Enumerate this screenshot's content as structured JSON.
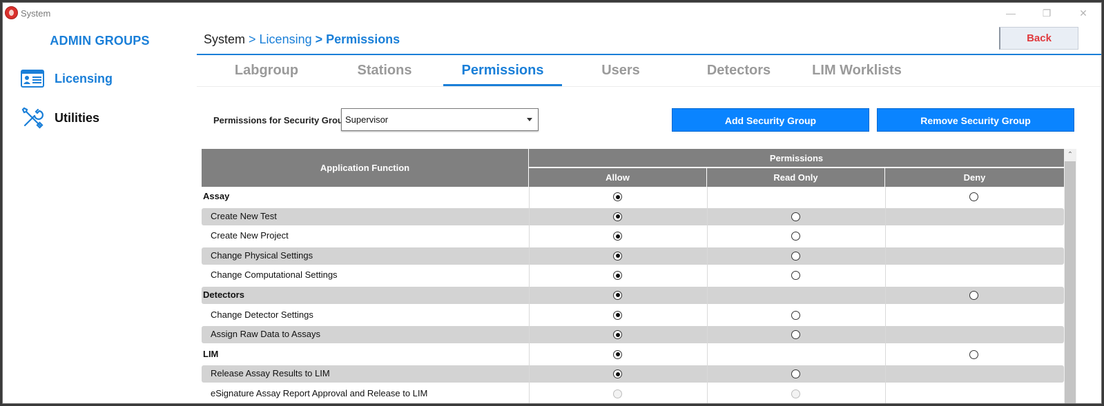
{
  "window": {
    "title": "System",
    "controls": {
      "minimize": "—",
      "restore": "❐",
      "close": "✕"
    }
  },
  "sidebar": {
    "title": "ADMIN GROUPS",
    "items": [
      {
        "label": "Licensing",
        "icon": "id-card-icon",
        "active": true
      },
      {
        "label": "Utilities",
        "icon": "tools-icon",
        "active": false
      }
    ]
  },
  "header": {
    "breadcrumb": {
      "root": "System",
      "sep": ">",
      "middle": "Licensing",
      "current": "Permissions"
    },
    "back_label": "Back"
  },
  "tabs": [
    {
      "label": "Labgroup",
      "active": false
    },
    {
      "label": "Stations",
      "active": false
    },
    {
      "label": "Permissions",
      "active": true
    },
    {
      "label": "Users",
      "active": false
    },
    {
      "label": "Detectors",
      "active": false
    },
    {
      "label": "LIM Worklists",
      "active": false
    }
  ],
  "security_group": {
    "label": "Permissions for Security Group",
    "selected": "Supervisor",
    "add_label": "Add Security Group",
    "remove_label": "Remove Security Group"
  },
  "table": {
    "col_function": "Application Function",
    "col_permissions": "Permissions",
    "col_allow": "Allow",
    "col_read_only": "Read Only",
    "col_deny": "Deny",
    "rows": [
      {
        "name": "Assay",
        "type": "group",
        "allow": "checked",
        "read_only": "none",
        "deny": "unchecked"
      },
      {
        "name": "Create New Test",
        "type": "child",
        "allow": "checked",
        "read_only": "unchecked",
        "deny": "none"
      },
      {
        "name": "Create New Project",
        "type": "child",
        "allow": "checked",
        "read_only": "unchecked",
        "deny": "none"
      },
      {
        "name": "Change Physical Settings",
        "type": "child",
        "allow": "checked",
        "read_only": "unchecked",
        "deny": "none"
      },
      {
        "name": "Change Computational Settings",
        "type": "child",
        "allow": "checked",
        "read_only": "unchecked",
        "deny": "none"
      },
      {
        "name": "Detectors",
        "type": "group",
        "allow": "checked",
        "read_only": "none",
        "deny": "unchecked"
      },
      {
        "name": "Change Detector Settings",
        "type": "child",
        "allow": "checked",
        "read_only": "unchecked",
        "deny": "none"
      },
      {
        "name": "Assign Raw Data to Assays",
        "type": "child",
        "allow": "checked",
        "read_only": "unchecked",
        "deny": "none"
      },
      {
        "name": "LIM",
        "type": "group",
        "allow": "checked",
        "read_only": "none",
        "deny": "unchecked"
      },
      {
        "name": "Release Assay Results to LIM",
        "type": "child",
        "allow": "checked",
        "read_only": "unchecked",
        "deny": "none"
      },
      {
        "name": "eSignature Assay Report Approval and Release to LIM",
        "type": "child",
        "allow": "disabled",
        "read_only": "disabled",
        "deny": "none"
      }
    ]
  },
  "scrollbar": {
    "up_arrow": "⌃"
  }
}
